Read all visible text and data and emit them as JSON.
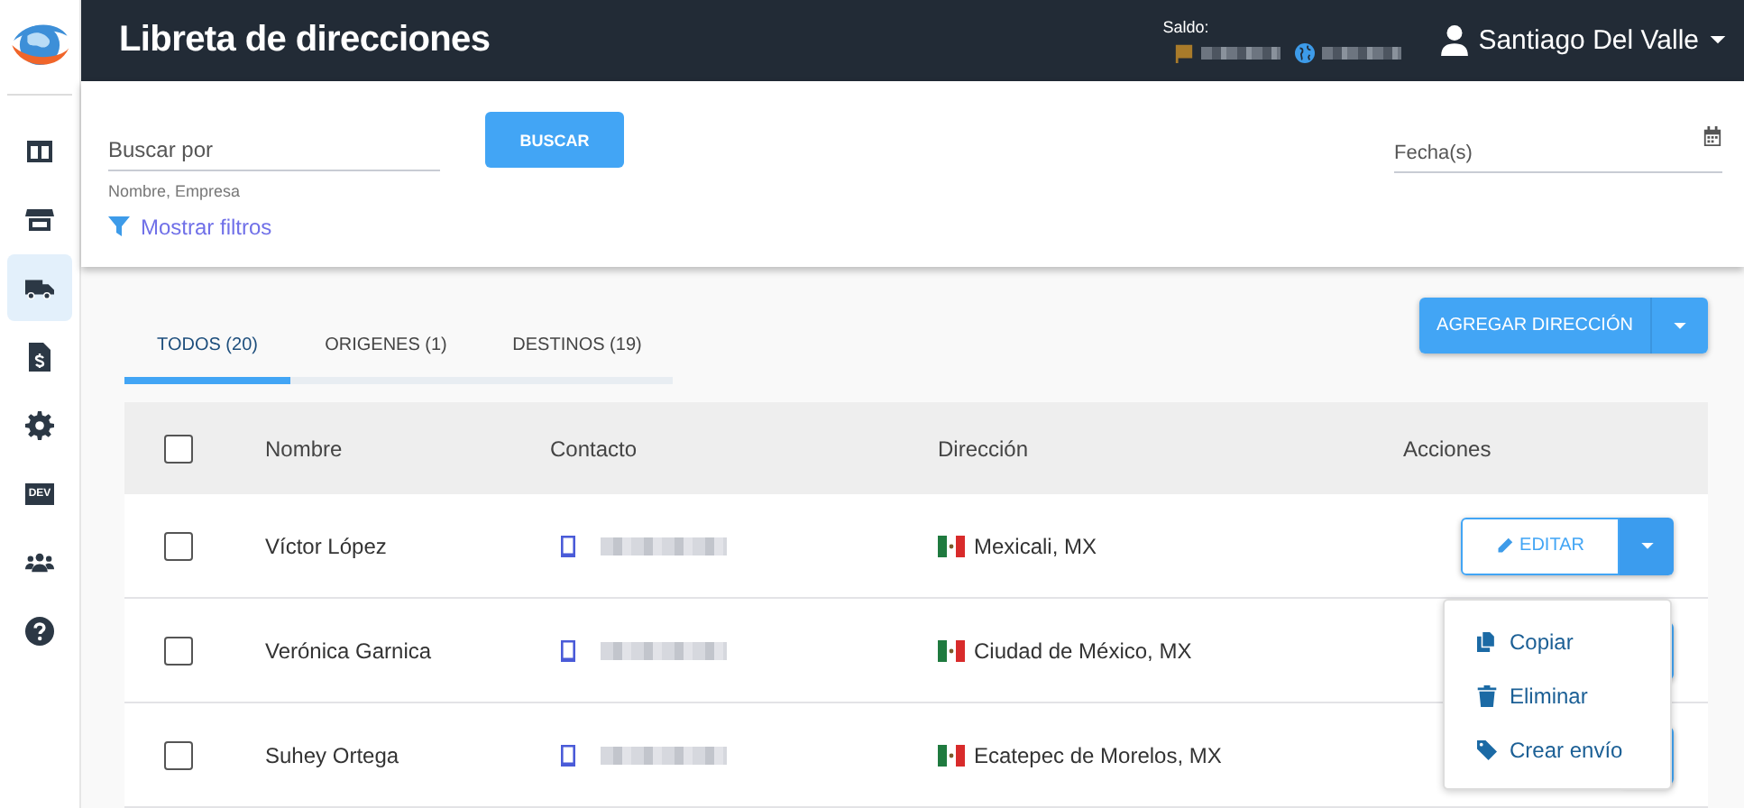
{
  "sidebar": {
    "items": [
      {
        "kind": "columns",
        "selected": false
      },
      {
        "kind": "store",
        "selected": false
      },
      {
        "kind": "truck",
        "selected": true
      },
      {
        "kind": "invoice",
        "selected": false
      },
      {
        "kind": "gear",
        "selected": false
      },
      {
        "kind": "dev",
        "label": "DEV",
        "selected": false
      },
      {
        "kind": "users",
        "selected": false
      },
      {
        "kind": "help",
        "selected": false
      }
    ]
  },
  "header": {
    "title": "Libreta de direcciones",
    "balance_label": "Saldo:",
    "balances": [
      {
        "kind": "flag",
        "blurred": true
      },
      {
        "kind": "globe",
        "blurred": true
      }
    ],
    "user": "Santiago Del Valle"
  },
  "filters": {
    "search": {
      "placeholder": "Buscar por",
      "hint": "Nombre, Empresa"
    },
    "search_button": "BUSCAR",
    "show_filters": "Mostrar filtros",
    "date": {
      "placeholder": "Fecha(s)"
    }
  },
  "tabs": [
    {
      "label": "TODOS (20)",
      "selected": true
    },
    {
      "label": "ORIGENES (1)",
      "selected": false
    },
    {
      "label": "DESTINOS (19)",
      "selected": false
    }
  ],
  "add_button": "AGREGAR DIRECCIÓN",
  "table": {
    "header_checked": false,
    "columns": [
      "Nombre",
      "Contacto",
      "Dirección",
      "Acciones"
    ],
    "rows": [
      {
        "checked": false,
        "name": "Víctor López",
        "contact_blurred": true,
        "address": "Mexicali, MX",
        "edit_label": "EDITAR",
        "menu_open": true
      },
      {
        "checked": false,
        "name": "Verónica Garnica",
        "contact_blurred": true,
        "address": "Ciudad de México, MX",
        "menu_open": false
      },
      {
        "checked": false,
        "name": "Suhey Ortega",
        "contact_blurred": true,
        "address": "Ecatepec de Morelos, MX",
        "menu_open": false
      }
    ]
  },
  "row_menu": [
    {
      "kind": "copy",
      "label": "Copiar"
    },
    {
      "kind": "trash",
      "label": "Eliminar"
    },
    {
      "kind": "tag",
      "label": "Crear envío"
    }
  ]
}
